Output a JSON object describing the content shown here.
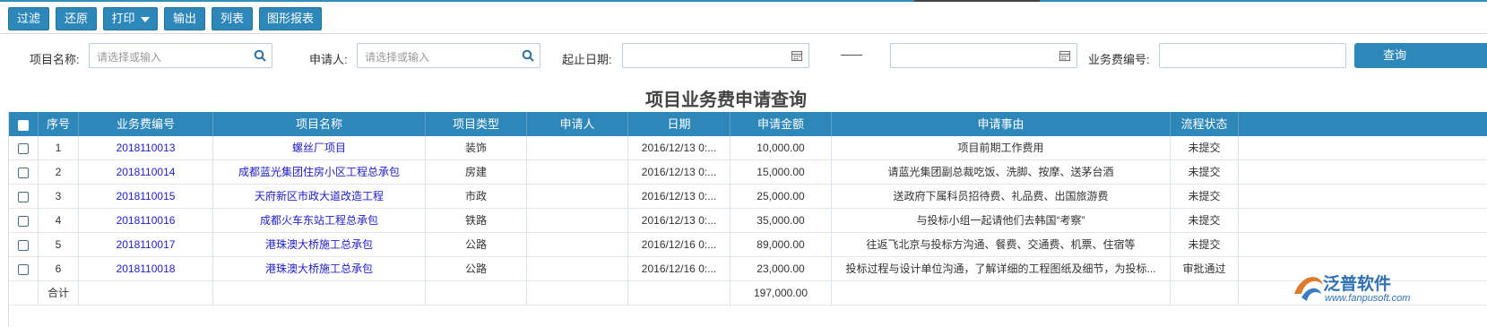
{
  "toolbar": {
    "buttons": [
      "过滤",
      "还原",
      "打印",
      "输出",
      "列表",
      "图形报表"
    ]
  },
  "filters": {
    "project_name_label": "项目名称:",
    "project_name_placeholder": "请选择或输入",
    "applicant_label": "申请人:",
    "applicant_placeholder": "请选择或输入",
    "date_range_label": "起止日期:",
    "fee_no_label": "业务费编号:",
    "query_label": "查询"
  },
  "page_title": "项目业务费申请查询",
  "table": {
    "columns": [
      "序号",
      "业务费编号",
      "项目名称",
      "项目类型",
      "申请人",
      "日期",
      "申请金额",
      "申请事由",
      "流程状态"
    ],
    "rows": [
      {
        "no": "1",
        "fee_no": "2018110013",
        "project": "螺丝厂项目",
        "type": "装饰",
        "applicant": "",
        "date": "2016/12/13 0:...",
        "amount": "10,000.00",
        "reason": "项目前期工作费用",
        "status": "未提交"
      },
      {
        "no": "2",
        "fee_no": "2018110014",
        "project": "成都蓝光集团住房小区工程总承包",
        "type": "房建",
        "applicant": "",
        "date": "2016/12/13 0:...",
        "amount": "15,000.00",
        "reason": "请蓝光集团副总裁吃饭、洗脚、按摩、送茅台酒",
        "status": "未提交"
      },
      {
        "no": "3",
        "fee_no": "2018110015",
        "project": "天府新区市政大道改造工程",
        "type": "市政",
        "applicant": "",
        "date": "2016/12/13 0:...",
        "amount": "25,000.00",
        "reason": "送政府下属科员招待费、礼品费、出国旅游费",
        "status": "未提交"
      },
      {
        "no": "4",
        "fee_no": "2018110016",
        "project": "成都火车东站工程总承包",
        "type": "铁路",
        "applicant": "",
        "date": "2016/12/13 0:...",
        "amount": "35,000.00",
        "reason": "与投标小组一起请他们去韩国“考察”",
        "status": "未提交"
      },
      {
        "no": "5",
        "fee_no": "2018110017",
        "project": "港珠澳大桥施工总承包",
        "type": "公路",
        "applicant": "",
        "date": "2016/12/16 0:...",
        "amount": "89,000.00",
        "reason": "往返飞北京与投标方沟通、餐费、交通费、机票、住宿等",
        "status": "未提交"
      },
      {
        "no": "6",
        "fee_no": "2018110018",
        "project": "港珠澳大桥施工总承包",
        "type": "公路",
        "applicant": "",
        "date": "2016/12/16 0:...",
        "amount": "23,000.00",
        "reason": "投标过程与设计单位沟通，了解详细的工程图纸及细节，为投标...",
        "status": "审批通过"
      }
    ],
    "total_label": "合计",
    "total_amount": "197,000.00"
  },
  "logo": {
    "name": "泛普软件",
    "url": "www.fanpusoft.com"
  },
  "colors": {
    "accent": "#2e87b9",
    "link": "#2020c8"
  }
}
